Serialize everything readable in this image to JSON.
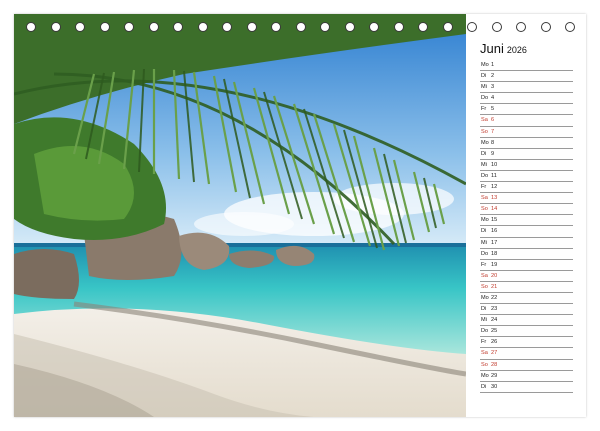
{
  "calendar": {
    "month": "Juni",
    "year": "2026",
    "days": [
      {
        "wd": "Mo",
        "d": "1",
        "weekend": false
      },
      {
        "wd": "Di",
        "d": "2",
        "weekend": false
      },
      {
        "wd": "Mi",
        "d": "3",
        "weekend": false
      },
      {
        "wd": "Do",
        "d": "4",
        "weekend": false
      },
      {
        "wd": "Fr",
        "d": "5",
        "weekend": false
      },
      {
        "wd": "Sa",
        "d": "6",
        "weekend": true
      },
      {
        "wd": "So",
        "d": "7",
        "weekend": true
      },
      {
        "wd": "Mo",
        "d": "8",
        "weekend": false
      },
      {
        "wd": "Di",
        "d": "9",
        "weekend": false
      },
      {
        "wd": "Mi",
        "d": "10",
        "weekend": false
      },
      {
        "wd": "Do",
        "d": "11",
        "weekend": false
      },
      {
        "wd": "Fr",
        "d": "12",
        "weekend": false
      },
      {
        "wd": "Sa",
        "d": "13",
        "weekend": true
      },
      {
        "wd": "So",
        "d": "14",
        "weekend": true
      },
      {
        "wd": "Mo",
        "d": "15",
        "weekend": false
      },
      {
        "wd": "Di",
        "d": "16",
        "weekend": false
      },
      {
        "wd": "Mi",
        "d": "17",
        "weekend": false
      },
      {
        "wd": "Do",
        "d": "18",
        "weekend": false
      },
      {
        "wd": "Fr",
        "d": "19",
        "weekend": false
      },
      {
        "wd": "Sa",
        "d": "20",
        "weekend": true
      },
      {
        "wd": "So",
        "d": "21",
        "weekend": true
      },
      {
        "wd": "Mo",
        "d": "22",
        "weekend": false
      },
      {
        "wd": "Di",
        "d": "23",
        "weekend": false
      },
      {
        "wd": "Mi",
        "d": "24",
        "weekend": false
      },
      {
        "wd": "Do",
        "d": "25",
        "weekend": false
      },
      {
        "wd": "Fr",
        "d": "26",
        "weekend": false
      },
      {
        "wd": "Sa",
        "d": "27",
        "weekend": true
      },
      {
        "wd": "So",
        "d": "28",
        "weekend": true
      },
      {
        "wd": "Mo",
        "d": "29",
        "weekend": false
      },
      {
        "wd": "Di",
        "d": "30",
        "weekend": false
      }
    ]
  },
  "colors": {
    "weekend": "#c0392b",
    "text": "#222222",
    "sky": "#6aa9de",
    "sea": "#3fc4c9",
    "sand": "#efeae1"
  }
}
